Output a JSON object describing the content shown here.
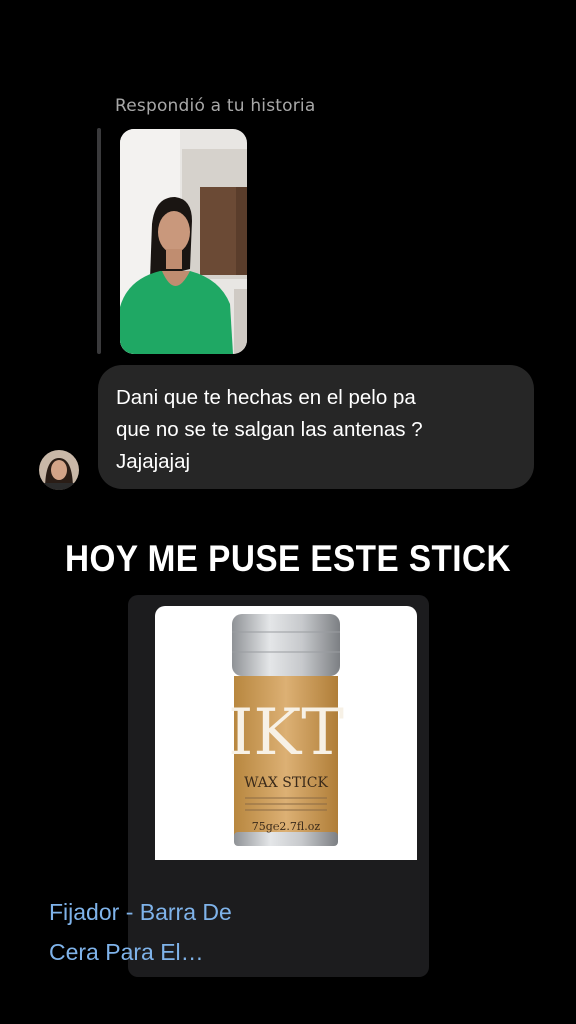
{
  "story_reply": {
    "label": "Respondió a tu historia"
  },
  "message": {
    "line1": "Dani que te hechas en el pelo pa",
    "line2": "que no se te salgan las antenas ?",
    "line3": "Jajajajaj"
  },
  "overlay": {
    "headline": "HOY ME PUSE ESTE STICK"
  },
  "product_card": {
    "brand_logo_text": "IKT",
    "product_name_on_package": "WAX STICK",
    "package_weight": "75g℮2.7fl.oz",
    "title_line1": "Fijador - Barra De",
    "title_line2": "Cera Para El…"
  },
  "colors": {
    "background": "#000000",
    "bubble": "#262626",
    "card": "#1c1c1e",
    "link": "#7fb3ea",
    "story_shirt": "#1fa864"
  }
}
